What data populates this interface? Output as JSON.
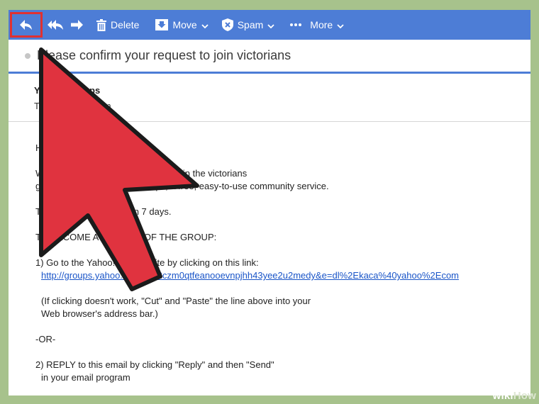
{
  "toolbar": {
    "delete_label": "Delete",
    "move_label": "Move",
    "spam_label": "Spam",
    "more_label": "More"
  },
  "email": {
    "subject": "Please confirm your request to join victorians",
    "sender_name": "Yahoo! Groups",
    "sender_address": "To: ...@yahoo.com",
    "greeting": "Hello,",
    "para1_line1": "We have received your request to join the victorians",
    "para1_line2": "group hosted by Yahoo! Groups, a free, easy-to-use community service.",
    "para2": "This request will expire in 7 days.",
    "heading": "TO BECOME A MEMBER OF THE GROUP:",
    "step1": "1) Go to the Yahoo! Groups site by clicking on this link:",
    "link": "http://groups.yahoo.com/i?i=2czm0qtfeanooevnpjhh43yee2u2medy&e=dl%2Ekaca%40yahoo%2Ecom",
    "note_line1": "(If clicking doesn't work, \"Cut\" and \"Paste\" the line above into your",
    "note_line2": "Web browser's address bar.)",
    "or": "-OR-",
    "step2_line1": "2) REPLY to this email by clicking \"Reply\" and then \"Send\"",
    "step2_line2": "in your email program"
  },
  "watermark": {
    "wiki": "wiki",
    "how": "How"
  },
  "colors": {
    "toolbar": "#4d7dd6",
    "highlight": "#e03131",
    "arrow": "#e0333f",
    "background": "#a7c28c"
  }
}
